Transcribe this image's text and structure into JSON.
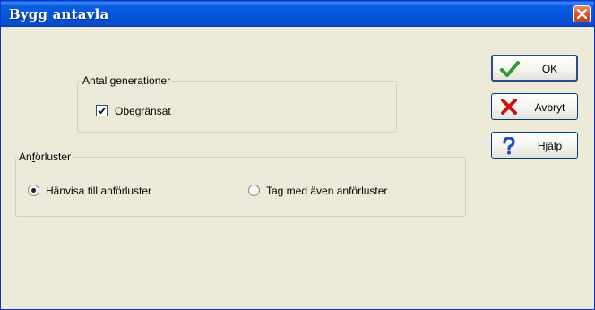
{
  "window": {
    "title": "Bygg antavla",
    "close_icon": "close-icon"
  },
  "generations": {
    "legend": "Antal generationer",
    "unlimited": {
      "label_accel": "O",
      "label_rest": "begränsat",
      "checked": true
    }
  },
  "pedigree_collapse": {
    "legend_pre": "An",
    "legend_accel": "f",
    "legend_rest": "örluster",
    "options": [
      {
        "label": "Hänvisa till anförluster",
        "selected": true
      },
      {
        "label": "Tag med även anförluster",
        "selected": false
      }
    ]
  },
  "buttons": {
    "ok": {
      "label": "OK",
      "icon": "checkmark-icon"
    },
    "cancel": {
      "label": "Avbryt",
      "icon": "red-x-icon"
    },
    "help": {
      "label_accel": "H",
      "label_rest": "jälp",
      "icon": "question-mark-icon"
    }
  },
  "colors": {
    "titlebar": "#0653d8",
    "dialog_bg": "#ece9d8",
    "ok_check": "#2e9a2e",
    "cancel_x": "#cc1111",
    "help_q": "#1f4fbf"
  }
}
